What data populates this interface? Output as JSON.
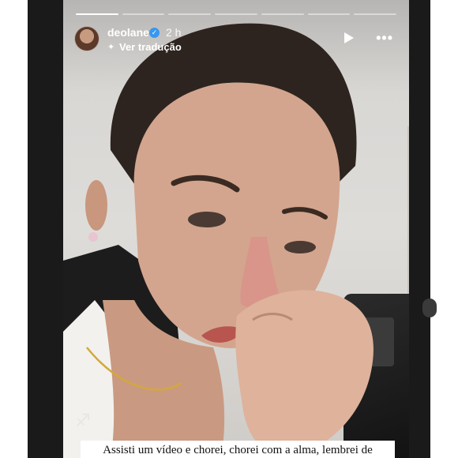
{
  "story": {
    "progress_segments": 7,
    "active_segment": 0,
    "username": "deolane",
    "timestamp": "2 h",
    "translate_label": "Ver tradução",
    "icons": {
      "verified": "verified-badge-icon",
      "translate": "translate-icon",
      "play": "play-icon",
      "more": "more-options-icon"
    },
    "caption": "Assisti um vídeo e chorei, chorei com a alma, lembrei de"
  },
  "colors": {
    "frame": "#1a1a1a",
    "verified": "#3897f0",
    "text": "#ffffff"
  }
}
